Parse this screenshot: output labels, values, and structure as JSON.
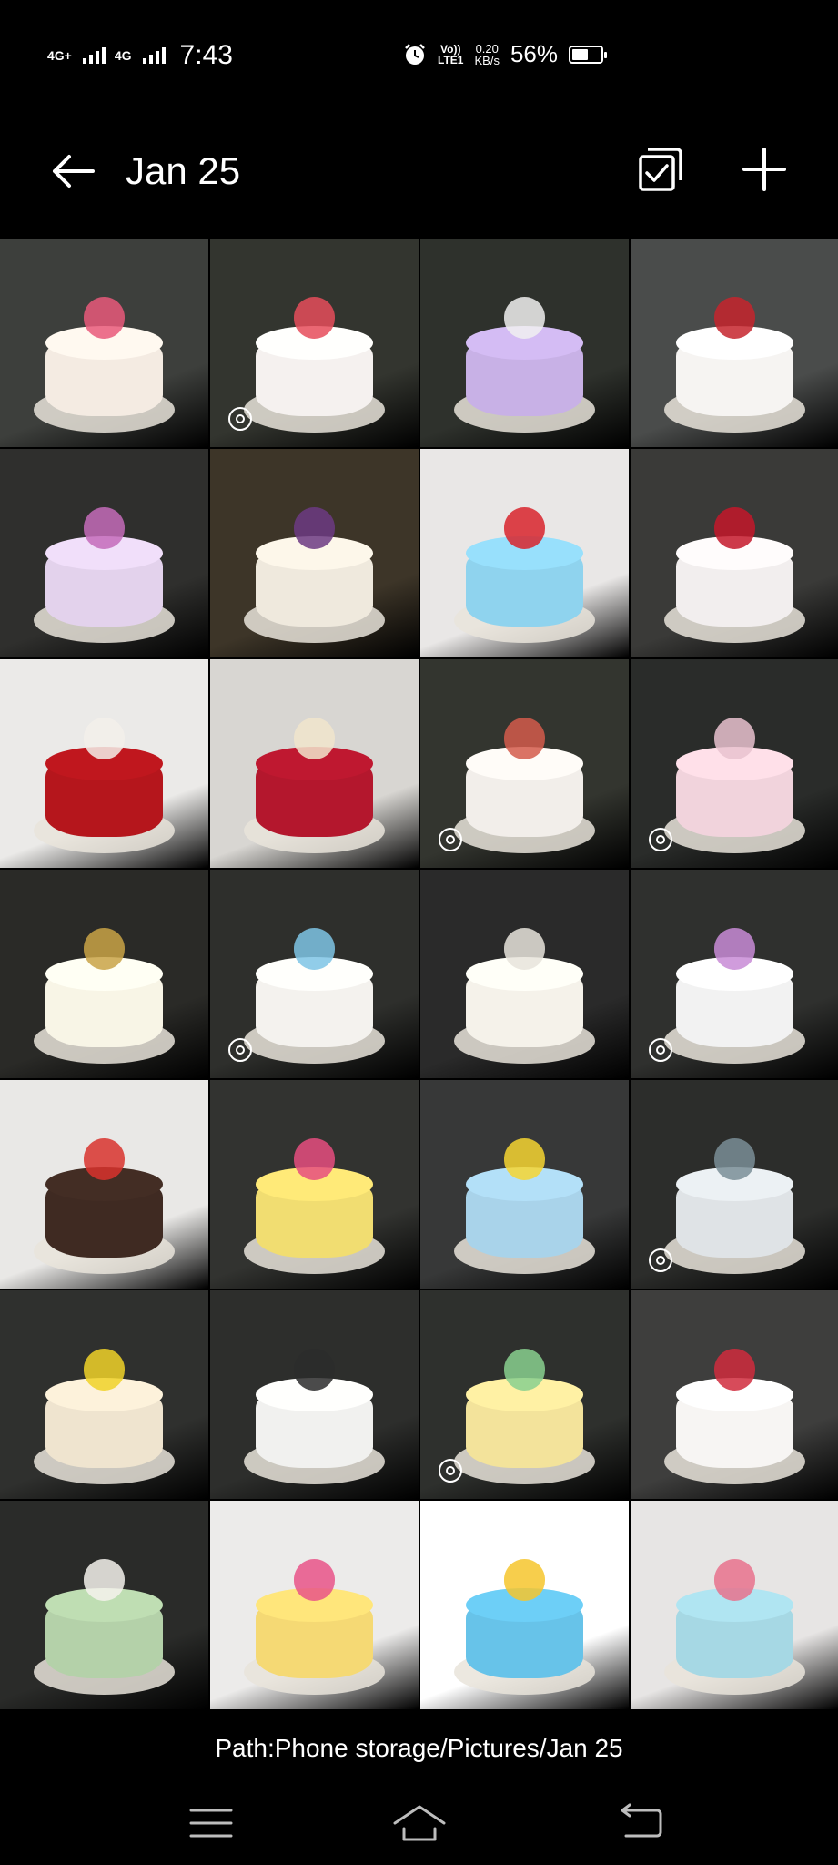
{
  "status_bar": {
    "network1": "4G+",
    "network2": "4G",
    "time": "7:43",
    "volte_line1": "Vo))",
    "volte_line2": "LTE1",
    "speed_value": "0.20",
    "speed_unit": "KB/s",
    "battery_percent": "56%",
    "battery_level": 0.56
  },
  "header": {
    "title": "Jan 25"
  },
  "grid": {
    "columns": 4,
    "rows": 7,
    "tiles": [
      {
        "bg": "#3d3f3c",
        "cake": "#f4ebe2",
        "accent": "#e9597a",
        "live": false
      },
      {
        "bg": "#33352f",
        "cake": "#f5f1ef",
        "accent": "#e64c5a",
        "live": true
      },
      {
        "bg": "#2e312c",
        "cake": "#c8b1e6",
        "accent": "#f0f0f0",
        "live": false
      },
      {
        "bg": "#4a4c4b",
        "cake": "#f6f4f2",
        "accent": "#c6252d",
        "live": false
      },
      {
        "bg": "#2f2f2d",
        "cake": "#e3d2ec",
        "accent": "#c46bba",
        "live": false
      },
      {
        "bg": "#3d3528",
        "cake": "#efe9dd",
        "accent": "#6c3a83",
        "live": false
      },
      {
        "bg": "#e9e7e6",
        "cake": "#8fd3ee",
        "accent": "#d8232c",
        "live": false
      },
      {
        "bg": "#3a3a38",
        "cake": "#f2eeee",
        "accent": "#c4182a",
        "live": false
      },
      {
        "bg": "#ebeae8",
        "cake": "#b5161c",
        "accent": "#f3f0ea",
        "live": false
      },
      {
        "bg": "#d8d6d2",
        "cake": "#b4172d",
        "accent": "#f1e5cd",
        "live": false
      },
      {
        "bg": "#33352f",
        "cake": "#f2eeea",
        "accent": "#d45a4b",
        "live": true
      },
      {
        "bg": "#2a2c2a",
        "cake": "#f1d3dc",
        "accent": "#e9c2cf",
        "live": true
      },
      {
        "bg": "#2a2a27",
        "cake": "#f8f5e6",
        "accent": "#c9a347",
        "live": false
      },
      {
        "bg": "#2e2f2c",
        "cake": "#f4f2ee",
        "accent": "#7ec4e5",
        "live": true
      },
      {
        "bg": "#2a2a2a",
        "cake": "#f5f2ea",
        "accent": "#e8e4dc",
        "live": false
      },
      {
        "bg": "#2f302e",
        "cake": "#f2f2f2",
        "accent": "#c88bd6",
        "live": true
      },
      {
        "bg": "#e9e8e6",
        "cake": "#3f2a22",
        "accent": "#d8332d",
        "live": false
      },
      {
        "bg": "#323330",
        "cake": "#f1dd71",
        "accent": "#e64e7f",
        "live": false
      },
      {
        "bg": "#373838",
        "cake": "#a9d3ea",
        "accent": "#f6d531",
        "live": false
      },
      {
        "bg": "#2c2d2b",
        "cake": "#dfe3e6",
        "accent": "#7a8e96",
        "live": true
      },
      {
        "bg": "#2f302e",
        "cake": "#efe4cf",
        "accent": "#f0d228",
        "live": false
      },
      {
        "bg": "#2d2e2c",
        "cake": "#f1f1ef",
        "accent": "#2b2b2b",
        "live": false
      },
      {
        "bg": "#2e302d",
        "cake": "#f3e39b",
        "accent": "#88d08f",
        "live": true
      },
      {
        "bg": "#3e3e3d",
        "cake": "#f7f5f3",
        "accent": "#d02c3d",
        "live": false
      },
      {
        "bg": "#2a2b29",
        "cake": "#b4d1a9",
        "accent": "#f4f2ec",
        "live": false
      },
      {
        "bg": "#ecebea",
        "cake": "#f5d974",
        "accent": "#e95388",
        "live": false
      },
      {
        "bg": "#ffffff",
        "cake": "#67c3e9",
        "accent": "#f6c52d",
        "live": false
      },
      {
        "bg": "#e7e5e4",
        "cake": "#a6d8e4",
        "accent": "#e8728d",
        "live": false
      }
    ]
  },
  "footer": {
    "path": "Path:Phone storage/Pictures/Jan 25"
  },
  "nav": {
    "menu_icon": "menu-icon",
    "home_icon": "home-icon",
    "back_icon": "back-icon"
  }
}
